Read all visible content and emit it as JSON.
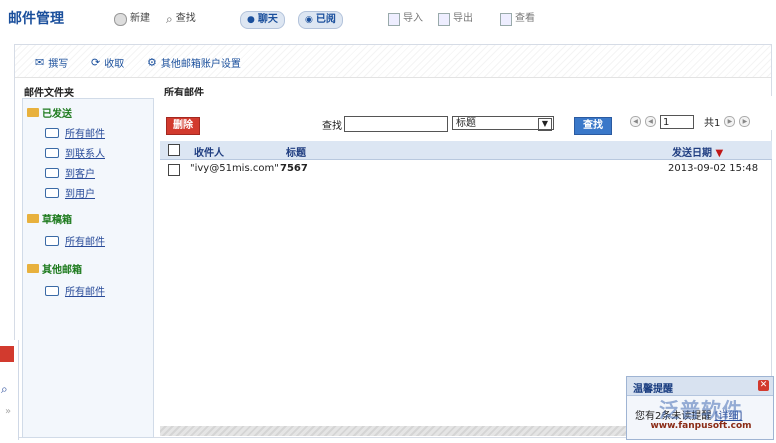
{
  "app": {
    "title": "邮件管理"
  },
  "toolbar": {
    "new": "新建",
    "search": "查找",
    "chat": "聊天",
    "read": "已阅",
    "import": "导入",
    "export": "导出",
    "view": "查看"
  },
  "actions": {
    "compose": "撰写",
    "receive": "收取",
    "other_settings": "其他邮箱账户设置"
  },
  "headers": {
    "folders": "邮件文件夹",
    "all_mail": "所有邮件"
  },
  "sidebar": {
    "groups": [
      {
        "label": "已发送",
        "items": [
          "所有邮件",
          "到联系人",
          "到客户",
          "到用户"
        ]
      },
      {
        "label": "草稿箱",
        "items": [
          "所有邮件"
        ]
      },
      {
        "label": "其他邮箱",
        "items": [
          "所有邮件"
        ]
      }
    ]
  },
  "search": {
    "delete_label": "删除",
    "find_label": "查找",
    "input_value": "",
    "field_selected": "标题",
    "find_button": "查找",
    "page_value": "1",
    "total_pages": "共1"
  },
  "table": {
    "columns": [
      "收件人",
      "标题",
      "发送日期"
    ],
    "rows": [
      {
        "recipient": "\"ivy@51mis.com\"",
        "subject": "7567",
        "date": "2013-09-02 15:48"
      }
    ]
  },
  "reminder": {
    "title": "温馨提醒",
    "body_prefix": "您有2条未读提醒",
    "body_link": "[详细]"
  },
  "watermark": {
    "brand": "泛普软件",
    "url": "www.fanpusoft.com"
  },
  "colors": {
    "accent": "#1a4f9c",
    "danger": "#d23a2e",
    "header_bg": "#dce6f3",
    "sidebar_bg": "#f3f7fc",
    "group_green": "#1c7a1c"
  }
}
